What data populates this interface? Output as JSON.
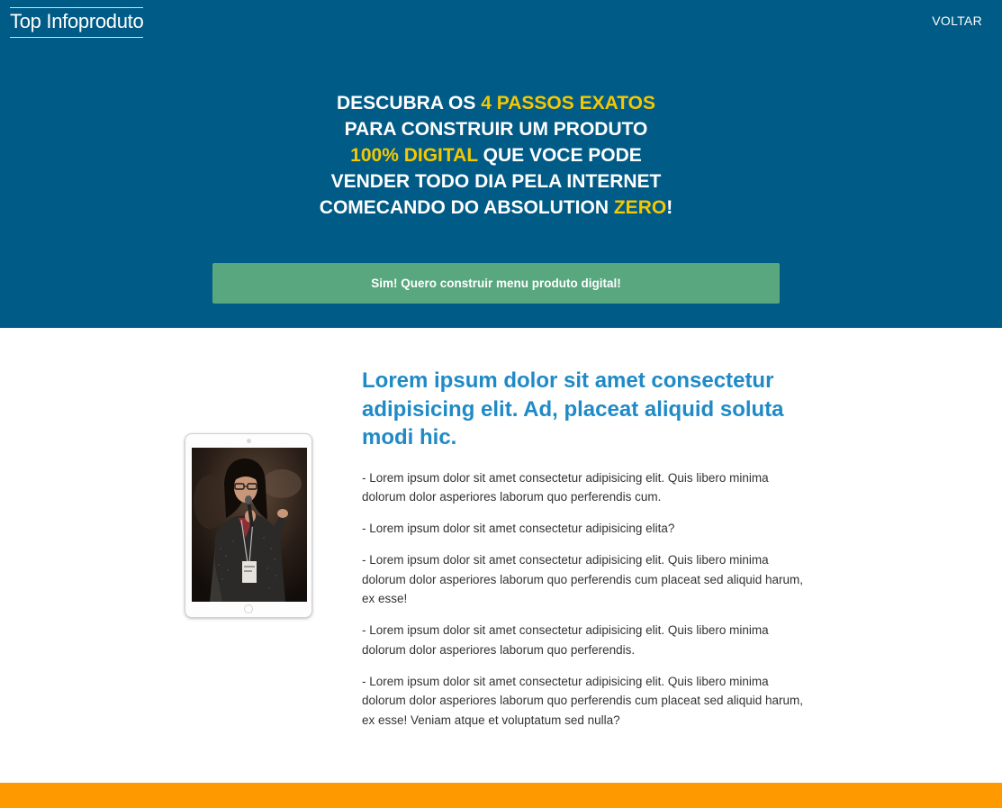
{
  "header": {
    "brand": "Top Infoproduto",
    "back_label": "VOLTAR"
  },
  "hero": {
    "headline": {
      "l1a": "DESCUBRA OS ",
      "l1b": "4 PASSOS EXATOS",
      "l2": "PARA CONSTRUIR UM PRODUTO",
      "l3a": "100% DIGITAL",
      "l3b": " QUE VOCE PODE",
      "l4": "VENDER TODO DIA PELA INTERNET",
      "l5a": "COMECANDO DO ABSOLUTION ",
      "l5b": "ZERO",
      "l5c": "!"
    },
    "cta_label": "Sim! Quero construir menu produto digital!"
  },
  "main": {
    "title": "Lorem ipsum dolor sit amet consectetur adipisicing elit. Ad, placeat aliquid soluta modi hic.",
    "paragraphs": [
      "- Lorem ipsum dolor sit amet consectetur adipisicing elit. Quis libero minima dolorum dolor asperiores laborum quo perferendis cum.",
      "- Lorem ipsum dolor sit amet consectetur adipisicing elita?",
      "- Lorem ipsum dolor sit amet consectetur adipisicing elit. Quis libero minima dolorum dolor asperiores laborum quo perferendis cum placeat sed aliquid harum, ex esse!",
      "- Lorem ipsum dolor sit amet consectetur adipisicing elit. Quis libero minima dolorum dolor asperiores laborum quo perferendis.",
      "- Lorem ipsum dolor sit amet consectetur adipisicing elit. Quis libero minima dolorum dolor asperiores laborum quo perferendis cum placeat sed aliquid harum, ex esse! Veniam atque et voluptatum sed nulla?"
    ]
  },
  "colors": {
    "hero_bg": "#005b86",
    "highlight": "#f5c800",
    "cta_bg": "#58a77e",
    "title": "#1f8ac6",
    "footer_bar": "#ff9900"
  }
}
